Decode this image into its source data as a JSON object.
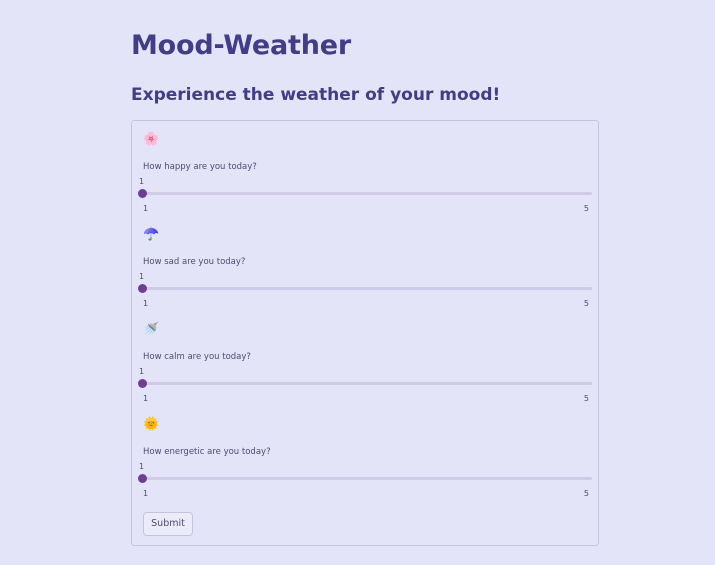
{
  "header": {
    "title": "Mood-Weather",
    "subtitle": "Experience the weather of your mood!"
  },
  "form": {
    "sliders": [
      {
        "icon": "cherry-blossom-icon",
        "emoji": "🌸",
        "label": "How happy are you today?",
        "value": 1,
        "min": 1,
        "max": 5
      },
      {
        "icon": "umbrella-icon",
        "emoji": "☂️",
        "label": "How sad are you today?",
        "value": 1,
        "min": 1,
        "max": 5
      },
      {
        "icon": "watering-can-icon",
        "emoji": "🚿",
        "label": "How calm are you today?",
        "value": 1,
        "min": 1,
        "max": 5
      },
      {
        "icon": "sun-icon",
        "emoji": "🌞",
        "label": "How energetic are you today?",
        "value": 1,
        "min": 1,
        "max": 5
      }
    ],
    "submit_label": "Submit"
  },
  "colors": {
    "background": "#e4e4f8",
    "accent": "#6f3e94",
    "title": "#433c87"
  }
}
